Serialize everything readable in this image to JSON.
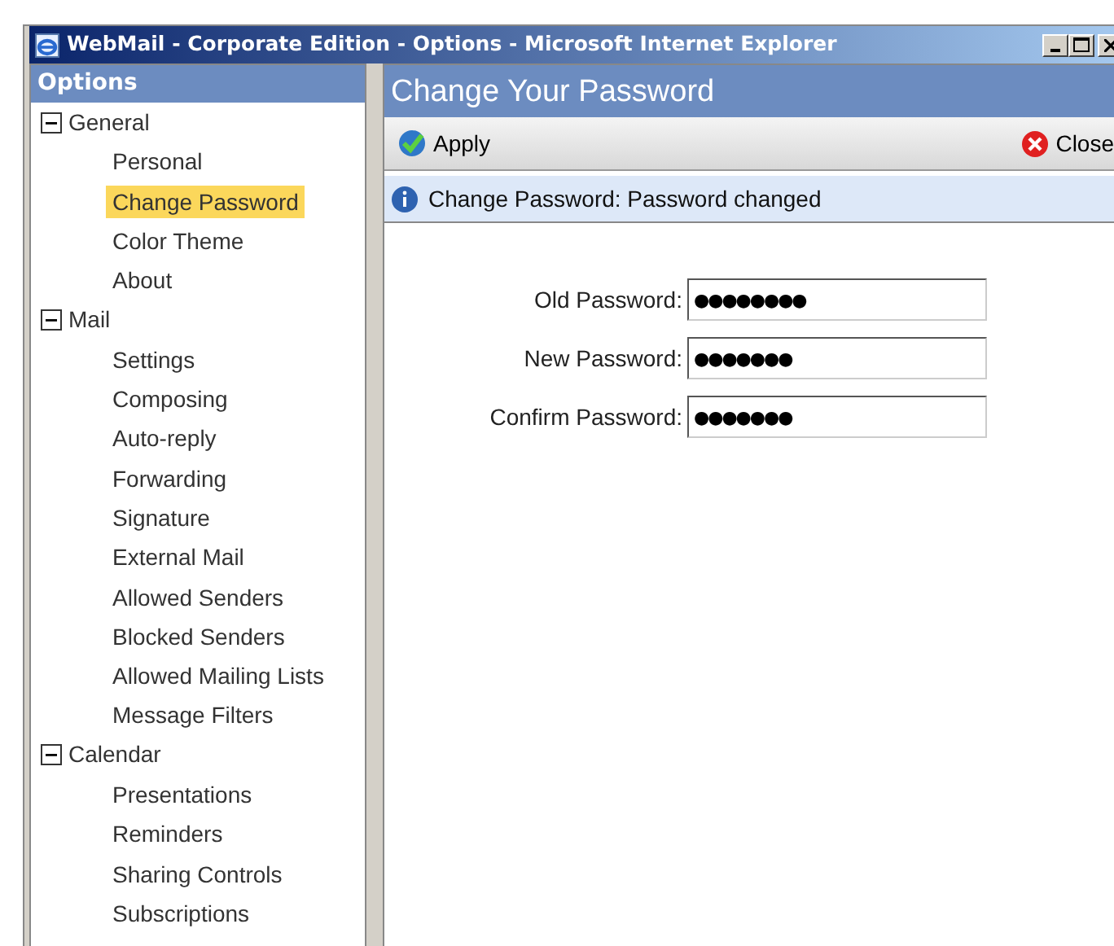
{
  "window": {
    "title": "WebMail - Corporate Edition - Options - Microsoft Internet Explorer"
  },
  "sidebar": {
    "title": "Options",
    "sections": [
      {
        "label": "General",
        "expanded": true,
        "children": [
          {
            "label": "Personal",
            "selected": false
          },
          {
            "label": "Change Password",
            "selected": true
          },
          {
            "label": "Color Theme",
            "selected": false
          },
          {
            "label": "About",
            "selected": false
          }
        ]
      },
      {
        "label": "Mail",
        "expanded": true,
        "children": [
          {
            "label": "Settings",
            "selected": false
          },
          {
            "label": "Composing",
            "selected": false
          },
          {
            "label": "Auto-reply",
            "selected": false
          },
          {
            "label": "Forwarding",
            "selected": false
          },
          {
            "label": "Signature",
            "selected": false
          },
          {
            "label": "External Mail",
            "selected": false
          },
          {
            "label": "Allowed Senders",
            "selected": false
          },
          {
            "label": "Blocked Senders",
            "selected": false
          },
          {
            "label": "Allowed Mailing Lists",
            "selected": false
          },
          {
            "label": "Message Filters",
            "selected": false
          }
        ]
      },
      {
        "label": "Calendar",
        "expanded": true,
        "children": [
          {
            "label": "Presentations",
            "selected": false
          },
          {
            "label": "Reminders",
            "selected": false
          },
          {
            "label": "Sharing Controls",
            "selected": false
          },
          {
            "label": "Subscriptions",
            "selected": false
          }
        ]
      }
    ]
  },
  "main": {
    "title": "Change Your Password",
    "toolbar": {
      "apply": "Apply",
      "close": "Close"
    },
    "message": "Change Password: Password changed",
    "fields": [
      {
        "label": "Old Password:",
        "value": "●●●●●●●●"
      },
      {
        "label": "New Password:",
        "value": "●●●●●●●"
      },
      {
        "label": "Confirm Password:",
        "value": "●●●●●●●"
      }
    ]
  }
}
